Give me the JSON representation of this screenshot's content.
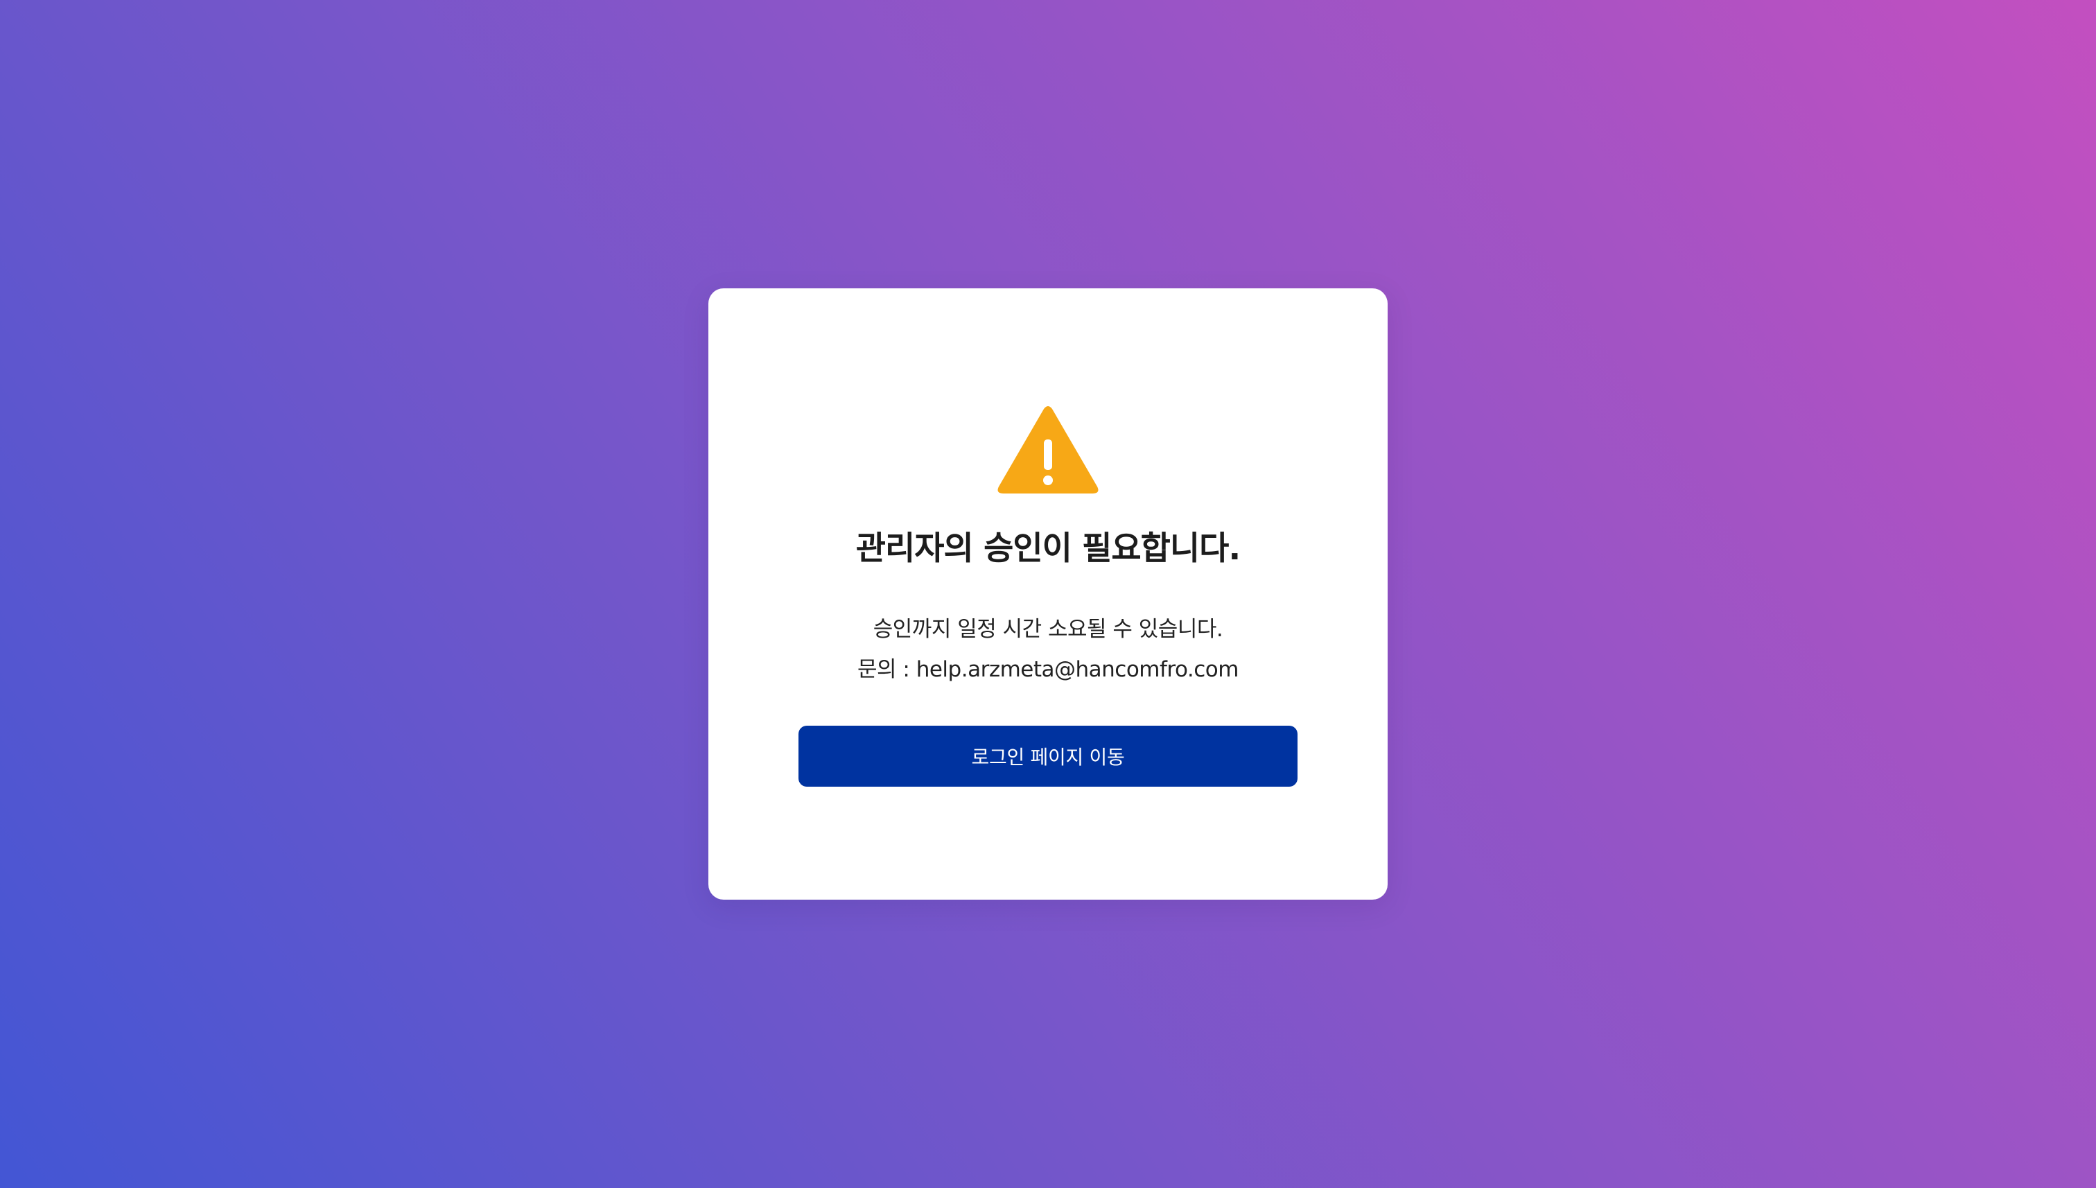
{
  "colors": {
    "accent_warning": "#f7a816",
    "button_bg": "#0033a0",
    "card_bg": "#ffffff"
  },
  "card": {
    "icon": "warning-triangle-icon",
    "title": "관리자의 승인이 필요합니다.",
    "description_line1": "승인까지 일정 시간 소요될 수 있습니다.",
    "description_line2": "문의 : help.arzmeta@hancomfro.com",
    "button_label": "로그인 페이지 이동"
  }
}
